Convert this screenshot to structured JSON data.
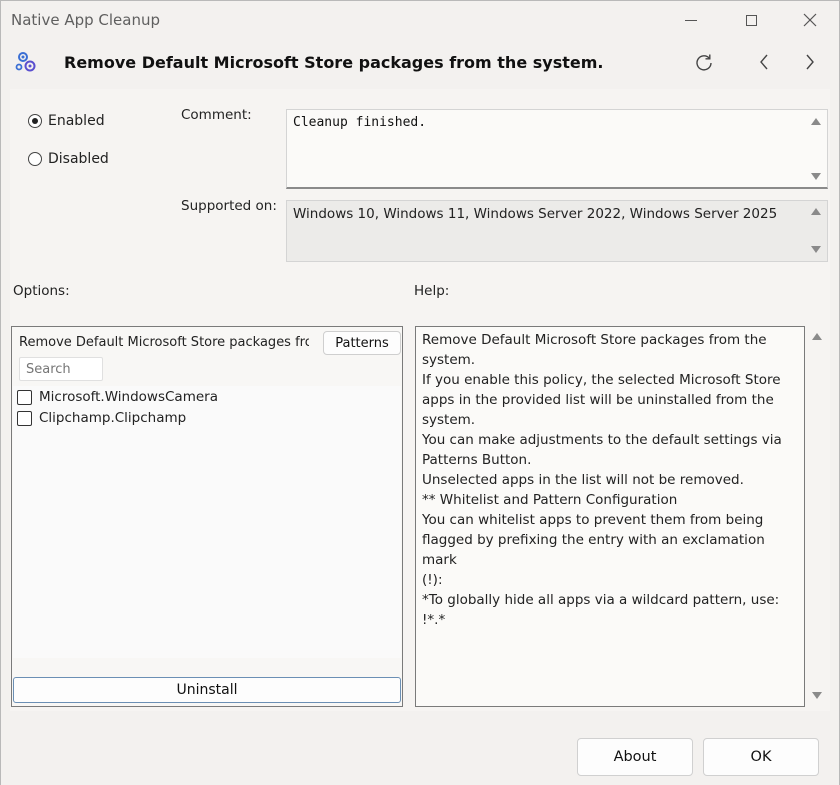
{
  "window": {
    "title": "Native App Cleanup"
  },
  "header": {
    "title": "Remove Default Microsoft Store packages from the system.",
    "icons": [
      "policy-gears-icon",
      "refresh-icon",
      "previous-icon",
      "next-icon"
    ]
  },
  "state": {
    "enabled_label": "Enabled",
    "disabled_label": "Disabled",
    "selected": "Enabled"
  },
  "comment": {
    "label": "Comment:",
    "value": "Cleanup finished."
  },
  "supported": {
    "label": "Supported on:",
    "value": "Windows 10, Windows 11, Windows Server 2022, Windows Server 2025"
  },
  "options": {
    "label": "Options:",
    "panel_title": "Remove Default Microsoft Store packages fro...",
    "patterns_label": "Patterns",
    "search_placeholder": "Search",
    "apps": [
      {
        "name": "Microsoft.WindowsCamera",
        "checked": false
      },
      {
        "name": "Clipchamp.Clipchamp",
        "checked": false
      }
    ],
    "uninstall_label": "Uninstall"
  },
  "help": {
    "label": "Help:",
    "lines": [
      "Remove Default Microsoft Store packages from the",
      "system.",
      "If you enable this policy, the selected Microsoft Store",
      "apps in the provided list will be uninstalled from the",
      "system.",
      "You can make adjustments to the default settings via",
      "Patterns Button.",
      "",
      "Unselected apps in the list will not be removed.",
      "",
      "** Whitelist and Pattern Configuration",
      "You can whitelist apps to prevent them from being",
      "flagged by prefixing the entry with an exclamation mark",
      "(!):",
      "",
      "*To globally hide all apps via a wildcard pattern, use: !*.*"
    ]
  },
  "footer": {
    "about_label": "About",
    "ok_label": "OK"
  },
  "colors": {
    "window_bg": "#f3f1ef",
    "accent_border": "#6b8fb4",
    "icon_blue": "#3b6fd4"
  }
}
